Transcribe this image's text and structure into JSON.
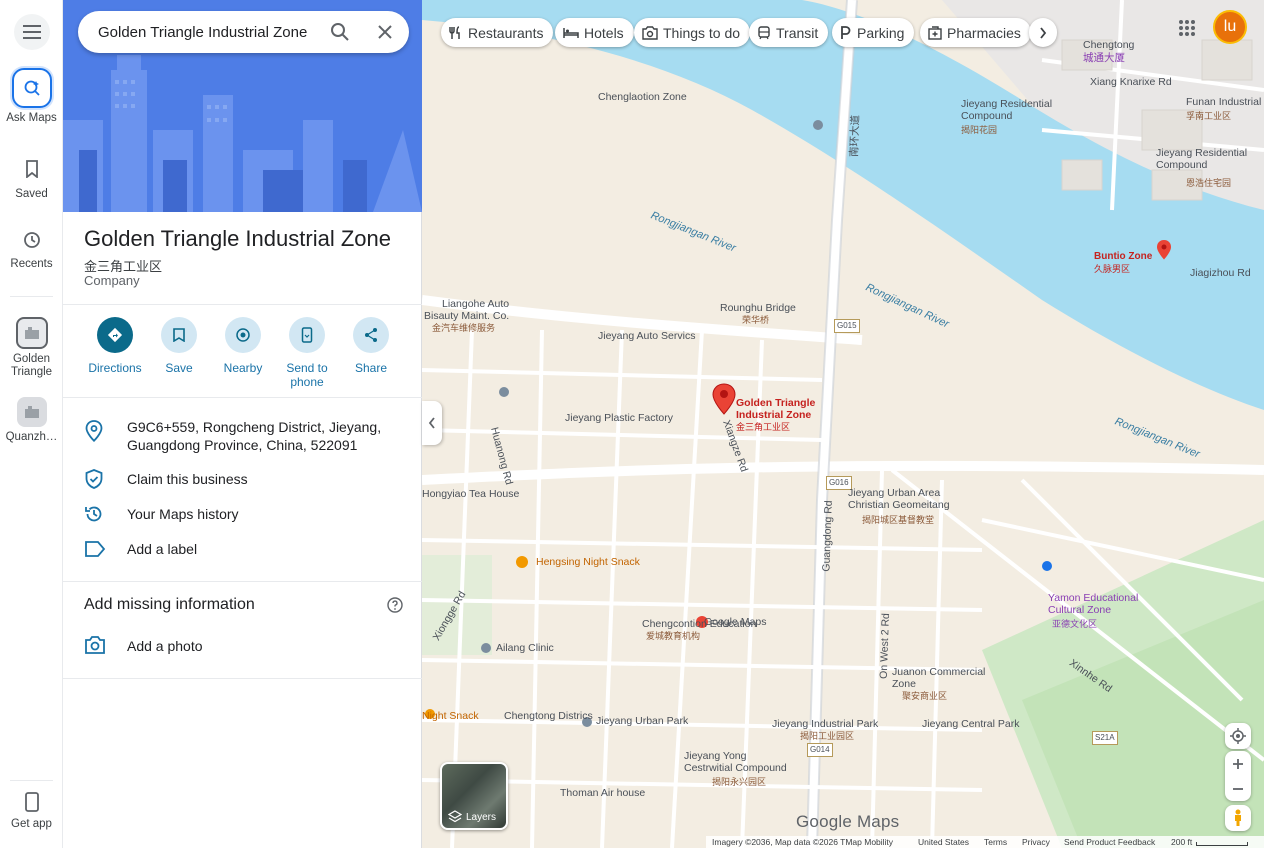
{
  "rail": {
    "menu_icon": "hamburger-menu-icon",
    "ask_maps": "Ask Maps",
    "saved": "Saved",
    "recents": "Recents",
    "golden": "Golden Triangle",
    "quanzhou": "Quanzh…",
    "get_app": "Get app"
  },
  "search": {
    "value": "Golden Triangle Industrial Zone"
  },
  "place": {
    "title": "Golden Triangle Industrial Zone",
    "chinese_name": "金三角工业区",
    "category": "Company"
  },
  "actions": {
    "directions": "Directions",
    "save": "Save",
    "nearby": "Nearby",
    "send_to_phone": "Send to phone",
    "share": "Share"
  },
  "info": {
    "address_line1": "G9C6+559, Rongcheng District, Jieyang,",
    "address_line2": "Guangdong Province, China, 522091",
    "claim": "Claim this business",
    "history": "Your Maps history",
    "label": "Add a label"
  },
  "missing": {
    "title": "Add missing information",
    "add_photo": "Add a photo"
  },
  "chips": {
    "restaurants": "Restaurants",
    "hotels": "Hotels",
    "things": "Things to do",
    "transit": "Transit",
    "parking": "Parking",
    "pharmacies": "Pharmacies"
  },
  "account": {
    "initial": "lu",
    "color": "#e8710a"
  },
  "map_labels": {
    "chengtong": "Chengtong",
    "chengtong_cn": "城通大厦",
    "xiang_knarixe": "Xiang Knarixe Rd",
    "funan": "Funan Industrial Pars",
    "funan_cn": "孚南工业区",
    "chenglaotion": "Chenglaotion Zone",
    "jieyang_residential": "Jieyang Residential Compound",
    "jieyang_residential_cn": "揭阳花园",
    "jieyang_residential2": "Jieyang Residential Compound",
    "jieyang_residential2_cn": "恩浩住宅园",
    "rongjiangan1": "Rongjiangan River",
    "rongjiangan2": "Rongjiangan River",
    "rongjiangan3": "Rongjiangan River",
    "buntio": "Buntio Zone",
    "buntio_cn": "久脉男区",
    "jiaguizhou": "Jiagizhou Rd",
    "liangohe": "Liangohe Auto",
    "bisauty": "Bisauty Maint. Co.",
    "bisauty_cn": "金汽车维修服务",
    "rounghu": "Rounghu Bridge",
    "rounghu_cn": "荣华桥",
    "road_g015_1": "G015",
    "road_g015_2": "G015",
    "jieyang_auto": "Jieyang Auto Servics",
    "jieyang_plastic": "Jieyang Plastic Factory",
    "pin_title": "Golden Triangle Industrial Zone",
    "pin_cn": "金三角工业区",
    "hongyiao": "Hongyiao Tea House",
    "jieyang_urban": "Jieyang Urban Area Christian Geomeitang",
    "jieyang_urban_cn": "揭阳城区基督教堂",
    "hengsing": "Hengsing Night Snack",
    "ailang": "Ailang Clinic",
    "chengcontion": "Chengcontion Education",
    "chengcontion_cn": "爱城教育机构",
    "google_maps_pin": "Google Maps",
    "yamon": "Yamon Educational Cultural Zone",
    "yamon_cn": "亚德文化区",
    "juanon": "Juanon Commercial Zone",
    "juanon_cn": "聚安商业区",
    "chengtong_districs": "Chengtong Districs",
    "night_snack": "Night Snack",
    "jieyang_urban_park": "Jieyang Urban Park",
    "jieyang_industrial_park": "Jieyang Industrial Park",
    "jieyang_industrial_park_cn": "揭阳工业园区",
    "jieyang_yong": "Jieyang Yong Cestrwitial Compound",
    "jieyang_yong_cn": "揭阳永兴园区",
    "jieyang_central": "Jieyang Central Park",
    "thoman": "Thoman Air house",
    "huanong": "Huanong Rd",
    "xiangze": "Xiangze Rd",
    "xiongge": "Xiongge Rd",
    "xinnhe": "Xinnhe Rd",
    "road_rd2": "On West 2 Rd",
    "road_g016": "G016",
    "road_g014": "G014",
    "road_s21a": "S21A",
    "road_vertical": "Guangdong Rd",
    "road_north": "南环大道"
  },
  "controls": {
    "layers": "Layers"
  },
  "google_logo": "Google Maps",
  "footer": {
    "imagery": "Imagery ©2036, Map data ©2026 TMap Mobility",
    "country": "United States",
    "terms": "Terms",
    "privacy": "Privacy",
    "feedback": "Send Product Feedback",
    "scale": "200 ft"
  }
}
